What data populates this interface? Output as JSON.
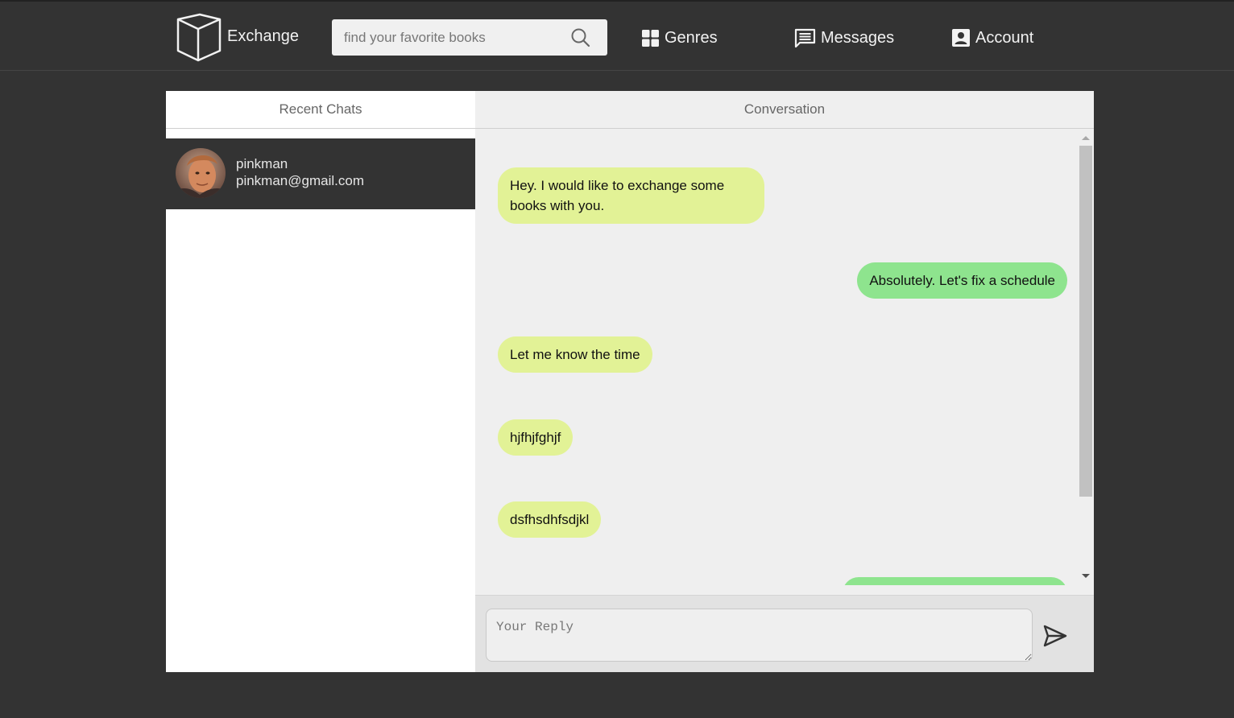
{
  "header": {
    "brand": "Exchange",
    "search_placeholder": "find your favorite books",
    "nav": {
      "genres": "Genres",
      "messages": "Messages",
      "account": "Account"
    }
  },
  "recent_chats": {
    "title": "Recent Chats",
    "items": [
      {
        "name": "pinkman",
        "email": "pinkman@gmail.com"
      }
    ]
  },
  "conversation": {
    "title": "Conversation",
    "messages": [
      {
        "from": "them",
        "text": "Hey. I would like to exchange some books with you."
      },
      {
        "from": "me",
        "text": "Absolutely. Let's fix a schedule"
      },
      {
        "from": "them",
        "text": "Let me know the time"
      },
      {
        "from": "them",
        "text": "hjfhjfghjf"
      },
      {
        "from": "them",
        "text": "dsfhsdhfsdjkl"
      },
      {
        "from": "me",
        "text": ""
      }
    ],
    "reply_placeholder": "Your Reply"
  },
  "colors": {
    "background": "#333333",
    "incoming_bubble": "#e2f296",
    "outgoing_bubble": "#8ee48e",
    "panel": "#efefef"
  }
}
